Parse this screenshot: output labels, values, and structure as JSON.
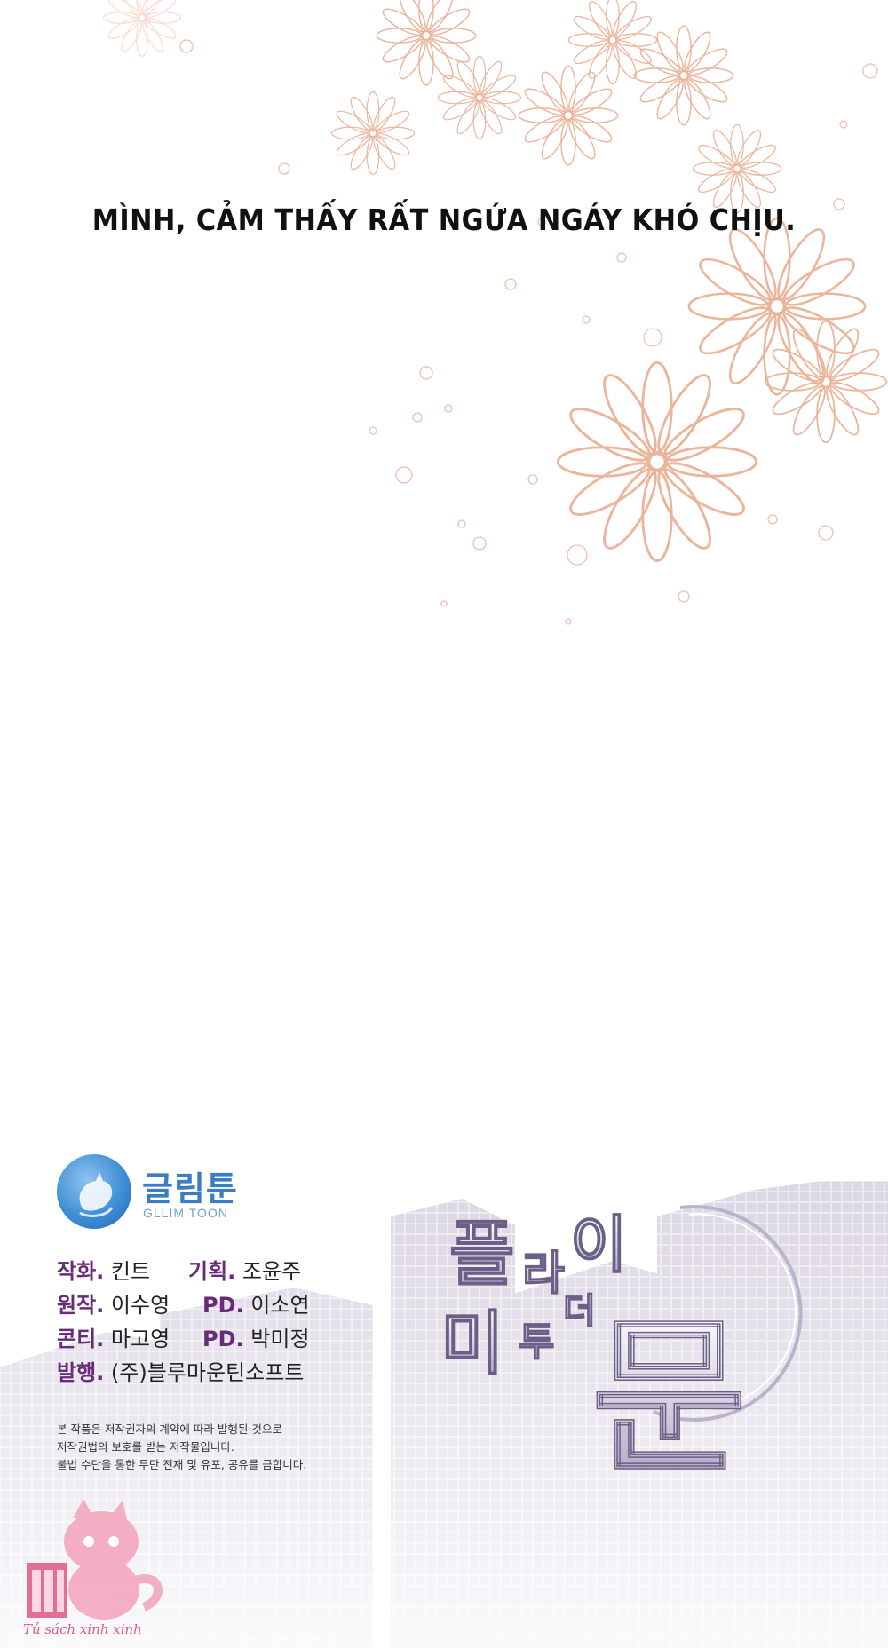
{
  "panel": {
    "caption": "MÌNH, CẢM THẤY RẤT NGỨA NGÁY KHÓ CHỊU."
  },
  "publisher": {
    "name_ko": "글림툰",
    "name_en": "GLLIM TOON"
  },
  "credits": [
    {
      "label": "작화.",
      "value": "킨트"
    },
    {
      "label": "기획.",
      "value": "조윤주"
    },
    {
      "label": "원작.",
      "value": "이수영"
    },
    {
      "label": "PD.",
      "value": "이소연"
    },
    {
      "label": "콘티.",
      "value": "마고영"
    },
    {
      "label": "PD.",
      "value": "박미정"
    },
    {
      "label": "발행.",
      "value": "(주)블루마운틴소프트"
    }
  ],
  "notice": [
    "본 작품은 저작권자의 계약에 따라 발행된 것으로",
    "저작권법의 보호를 받는 저작물입니다.",
    "불법 수단을 통한 무단 전재 및 유포, 공유를 금합니다."
  ],
  "title_logo": {
    "line1": [
      "플",
      "라",
      "이"
    ],
    "line2": [
      "미",
      "투",
      "더"
    ],
    "big": "문"
  },
  "watermark": "Tủ sách xinh xinh",
  "colors": {
    "flower_line": "#e8a88a",
    "credit_label": "#6a2a7a",
    "logo_blue": "#3c7cc2",
    "watermark_pink": "#e05a86"
  }
}
